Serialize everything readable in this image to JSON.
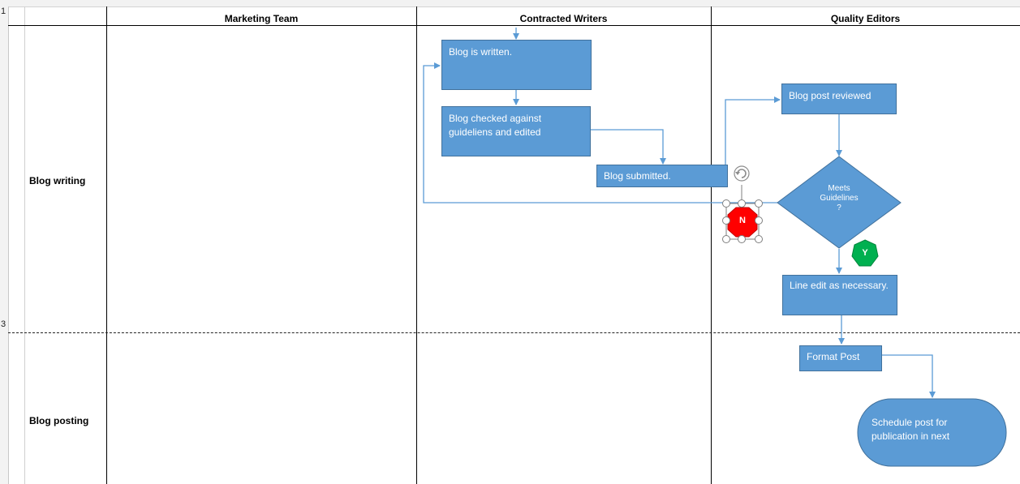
{
  "sheet": {
    "row_numbers": [
      "1",
      "3"
    ],
    "lanes": [
      "Marketing Team",
      "Contracted Writers",
      "Quality Editors"
    ],
    "phases": [
      "Blog writing",
      "Blog posting"
    ]
  },
  "flow": {
    "blog_written": "Blog is written.",
    "blog_checked": "Blog checked against guideliens and edited",
    "blog_submitted": "Blog submitted.",
    "blog_reviewed": "Blog post reviewed",
    "decision": [
      "Meets",
      "Guidelines",
      "?"
    ],
    "no_label": "N",
    "yes_label": "Y",
    "line_edit": "Line edit as necessary.",
    "format_post": "Format Post",
    "schedule_post": "Schedule post for publication in next"
  },
  "colors": {
    "shape_fill": "#5b9bd5",
    "shape_border": "#41719c",
    "connector": "#5b9bd5",
    "no_fill": "#ff0000",
    "yes_fill": "#00b050"
  },
  "icons": {
    "rotate_handle": "rotate-handle-icon"
  }
}
